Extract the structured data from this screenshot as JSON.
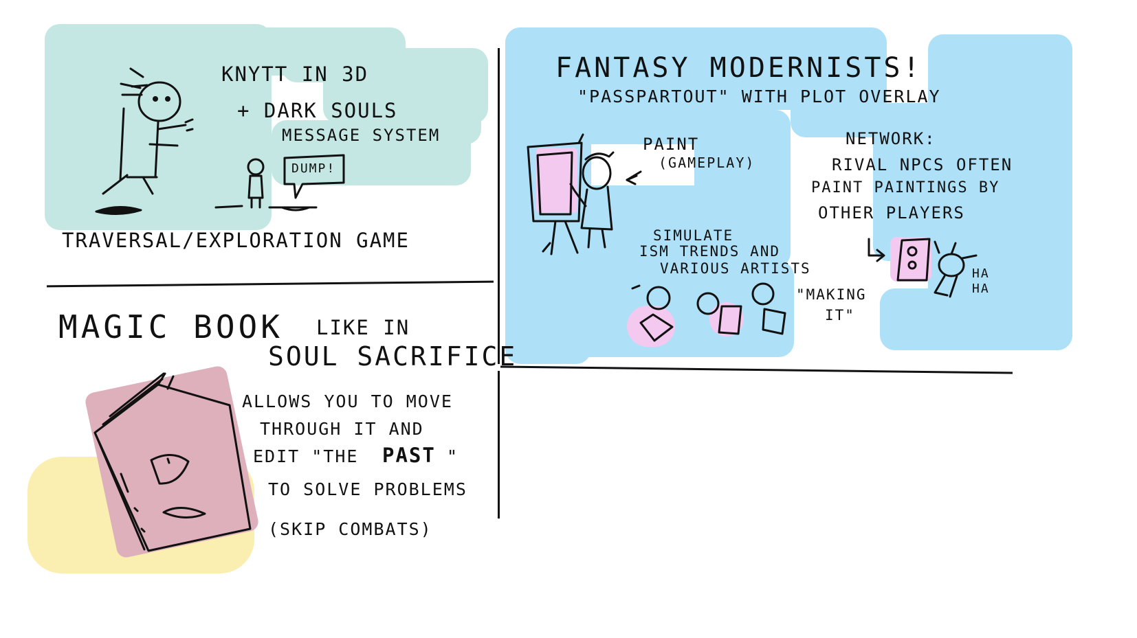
{
  "panels": {
    "top_left": {
      "title": "KNYTT IN 3D",
      "line2": "+ DARK SOULS",
      "line3": "MESSAGE SYSTEM",
      "bubble": "DUMP!",
      "footer": "TRAVERSAL/EXPLORATION GAME"
    },
    "top_right": {
      "title": "FANTASY MODERNISTS!",
      "subtitle": "\"PASSPARTOUT\" WITH PLOT OVERLAY",
      "paint": "PAINT",
      "gameplay": "(GAMEPLAY)",
      "network_1": "NETWORK:",
      "network_2": "RIVAL NPCS OFTEN",
      "network_3": "PAINT PAINTINGS BY",
      "network_4": "OTHER PLAYERS",
      "simulate_1": "SIMULATE",
      "simulate_2": "ISM TRENDS AND",
      "simulate_3": "VARIOUS ARTISTS",
      "making_1": "\"MAKING",
      "making_2": "IT\"",
      "haha_1": "HA",
      "haha_2": "HA"
    },
    "bottom_left": {
      "title": "MAGIC BOOK",
      "title_b": "LIKE IN",
      "title_c": "SOUL SACRIFICE",
      "desc_1": "ALLOWS YOU TO MOVE",
      "desc_2": "THROUGH IT AND",
      "desc_3_a": "EDIT \"THE",
      "desc_3_b": "PAST",
      "desc_3_c": "\"",
      "desc_4": "TO SOLVE PROBLEMS",
      "desc_5": "(SKIP COMBATS)"
    }
  },
  "colors": {
    "teal": "#c4e7e4",
    "sky": "#aee0f7",
    "pink": "#ddb0bb",
    "yellow": "#faeeb1",
    "lilac": "#f4c9f0",
    "ink": "#111111"
  },
  "icons": [
    "stick-figure-icon",
    "rabbit-figure-icon",
    "painter-icon",
    "easel-icon",
    "book-icon",
    "face-icon"
  ]
}
